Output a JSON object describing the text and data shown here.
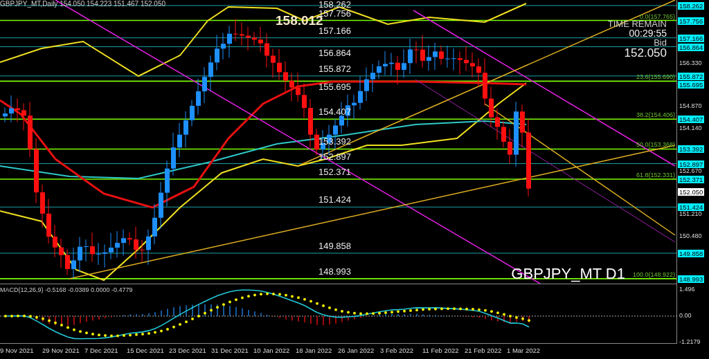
{
  "header": "GBPJPY_MT,Daily  154.050 154.223 151.467 152.050",
  "high_label": "158.012",
  "timer": {
    "title": "TIME REMAIN",
    "value": "00:29:55",
    "bid_label": "Bid",
    "bid": "152.050"
  },
  "symbol_label": "GBPJPY_MT D1",
  "levels": [
    {
      "label": "158.262",
      "tag": "158.262",
      "kind": "plain"
    },
    {
      "label": "157.756",
      "tag": "157.756",
      "kind": "fib",
      "fib_label": "0.0(157.765)"
    },
    {
      "label": "157.166",
      "tag": "157.166",
      "kind": "plain"
    },
    {
      "label": "156.864",
      "tag": "156.864",
      "kind": "plain"
    },
    {
      "label": "155.872",
      "tag": "155.872",
      "kind": "plain"
    },
    {
      "label": "155.695",
      "tag": "155.695",
      "kind": "fib",
      "fib_label": "23.6(155.690)"
    },
    {
      "label": "154.407",
      "tag": "154.407",
      "kind": "fib",
      "fib_label": "38.2(154.406)"
    },
    {
      "label": "153.392",
      "tag": "153.392",
      "kind": "fib",
      "fib_label": "50.0(153.368)"
    },
    {
      "label": "152.897",
      "tag": "152.897",
      "kind": "plain"
    },
    {
      "label": "152.371",
      "tag": "152.371",
      "kind": "fib",
      "fib_label": "61.8(152.331)"
    },
    {
      "label": "151.424",
      "tag": "151.424",
      "kind": "plain"
    },
    {
      "label": "149.858",
      "tag": "149.858",
      "kind": "plain"
    },
    {
      "label": "148.993",
      "tag": "148.993",
      "kind": "fib",
      "fib_label": "100.0(148.922)"
    }
  ],
  "axis_ticks": [
    "156.330",
    "154.870",
    "154.140",
    "152.670",
    "151.210",
    "150.480"
  ],
  "bid_tag": "152.050",
  "macd": {
    "header": "MACD(12,26,9) -0.5168 -0.0389 0.0000 -0.4779",
    "ticks": [
      "1.496",
      "0.00",
      "-1.2179"
    ]
  },
  "dates": [
    "9 Nov 2021",
    "29 Nov 2021",
    "7 Dec 2021",
    "15 Dec 2021",
    "23 Dec 2021",
    "31 Dec 2021",
    "10 Jan 2022",
    "18 Jan 2022",
    "26 Jan 2022",
    "3 Feb 2022",
    "11 Feb 2022",
    "21 Feb 2022",
    "1 Mar 2022"
  ]
}
